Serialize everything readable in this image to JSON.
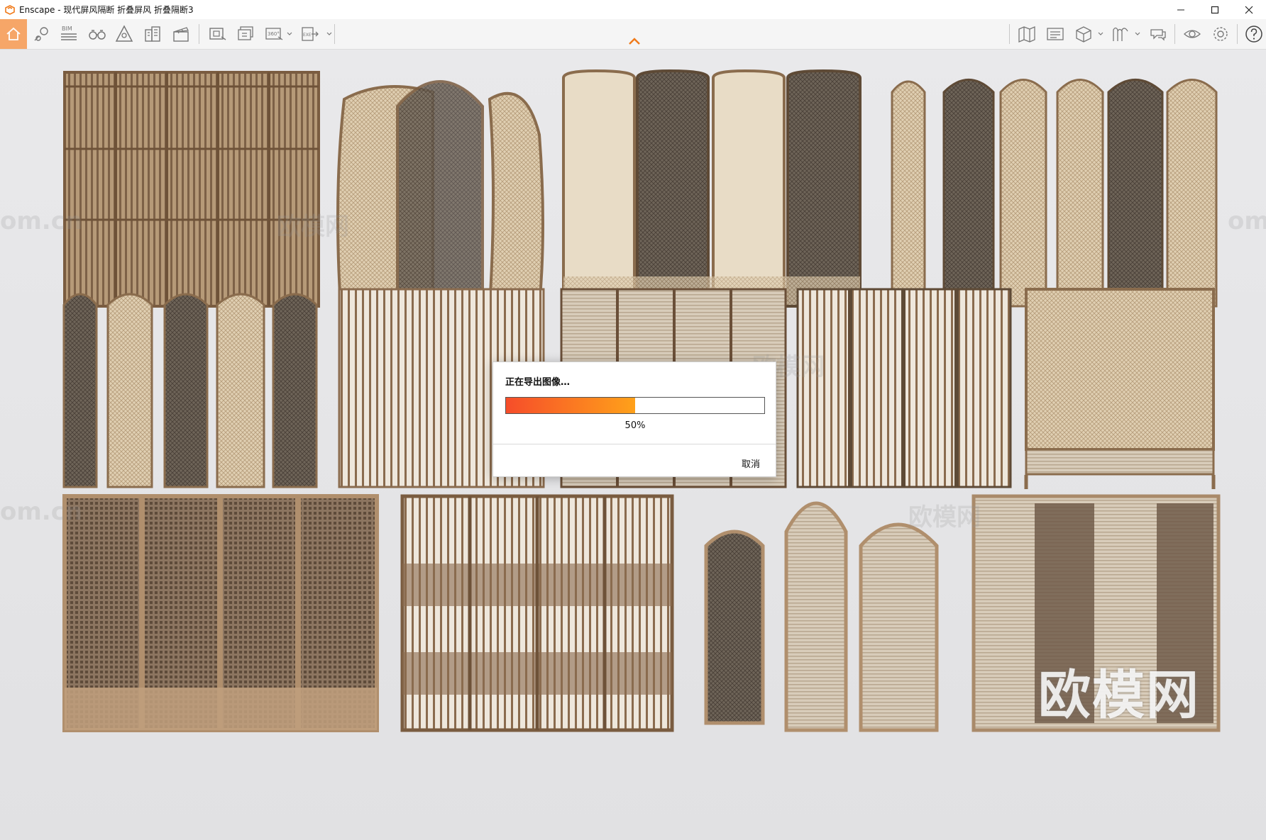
{
  "window": {
    "app_name": "Enscape",
    "title": "Enscape - 现代屏风隔断 折叠屏风 折叠隔断3",
    "controls": [
      "minimize-icon",
      "maximize-icon",
      "close-icon"
    ]
  },
  "toolbar": {
    "left_icons": [
      "home-icon",
      "location-pin-icon",
      "bim-icon",
      "binoculars-icon",
      "atmosphere-icon",
      "buildings-icon",
      "clapper-icon",
      "screenshot-icon",
      "batch-render-icon",
      "panorama-360-icon",
      "exe-export-icon"
    ],
    "bim_label": "BIM",
    "pano_label": "360°",
    "exe_label": "EXE",
    "right_icons": [
      "map-icon",
      "asset-library-icon",
      "cube-view-icon",
      "material-editor-icon",
      "collaboration-icon",
      "visibility-icon",
      "settings-icon",
      "help-icon"
    ]
  },
  "dialog": {
    "title": "正在导出图像…",
    "progress": 0.5,
    "progress_text": "50%",
    "cancel_label": "取消",
    "colors": {
      "fill_start": "#f64d2a",
      "fill_end": "#ffa11a"
    }
  },
  "watermark": {
    "text": "欧模网",
    "url_text": "om.cn"
  }
}
